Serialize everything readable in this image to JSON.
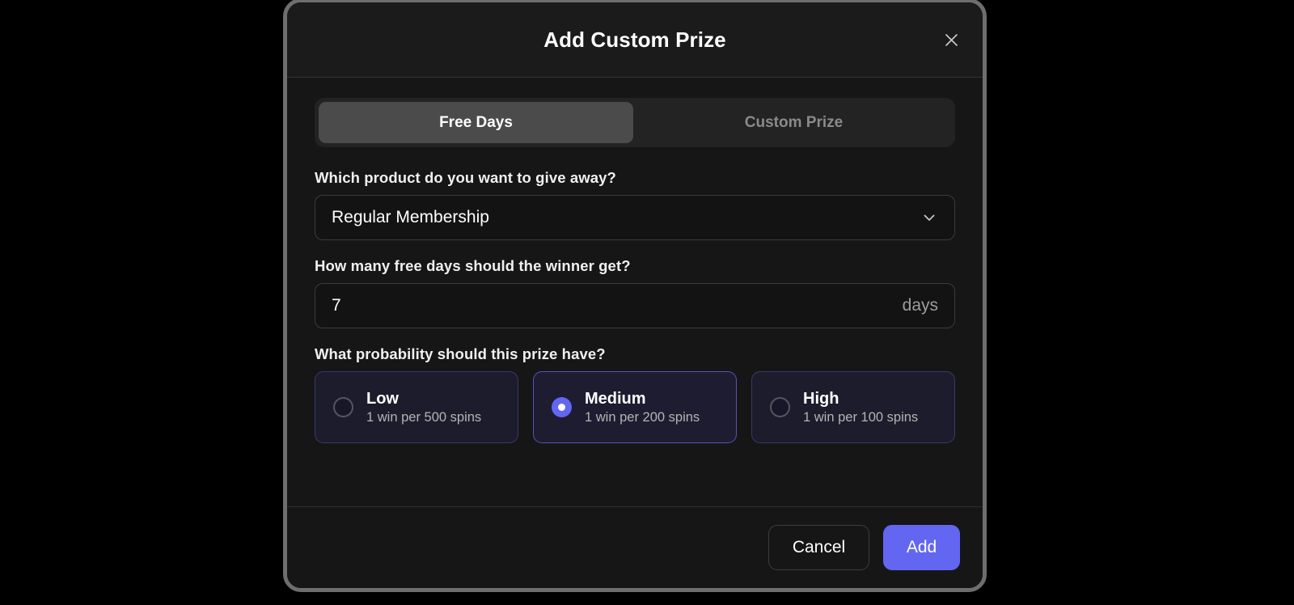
{
  "modal": {
    "title": "Add Custom Prize",
    "close_icon": "close-icon"
  },
  "tabs": [
    {
      "label": "Free Days",
      "active": true
    },
    {
      "label": "Custom Prize",
      "active": false
    }
  ],
  "fields": {
    "product": {
      "label": "Which product do you want to give away?",
      "value": "Regular Membership",
      "icon": "chevron-down-icon"
    },
    "free_days": {
      "label": "How many free days should the winner get?",
      "value": "7",
      "suffix": "days"
    },
    "probability": {
      "label": "What probability should this prize have?",
      "options": [
        {
          "title": "Low",
          "subtitle": "1 win per 500 spins",
          "selected": false
        },
        {
          "title": "Medium",
          "subtitle": "1 win per 200 spins",
          "selected": true
        },
        {
          "title": "High",
          "subtitle": "1 win per 100 spins",
          "selected": false
        }
      ]
    }
  },
  "footer": {
    "cancel_label": "Cancel",
    "add_label": "Add"
  },
  "colors": {
    "accent": "#6366f1",
    "modal_bg": "#161616",
    "header_bg": "#1b1b1b",
    "tab_active_bg": "#4b4b4b",
    "card_bg": "#1c1c2c",
    "card_border": "#3d3868",
    "card_border_selected": "#5a52b8",
    "frame_ring": "#6e6e6e",
    "backdrop": "#000000"
  }
}
